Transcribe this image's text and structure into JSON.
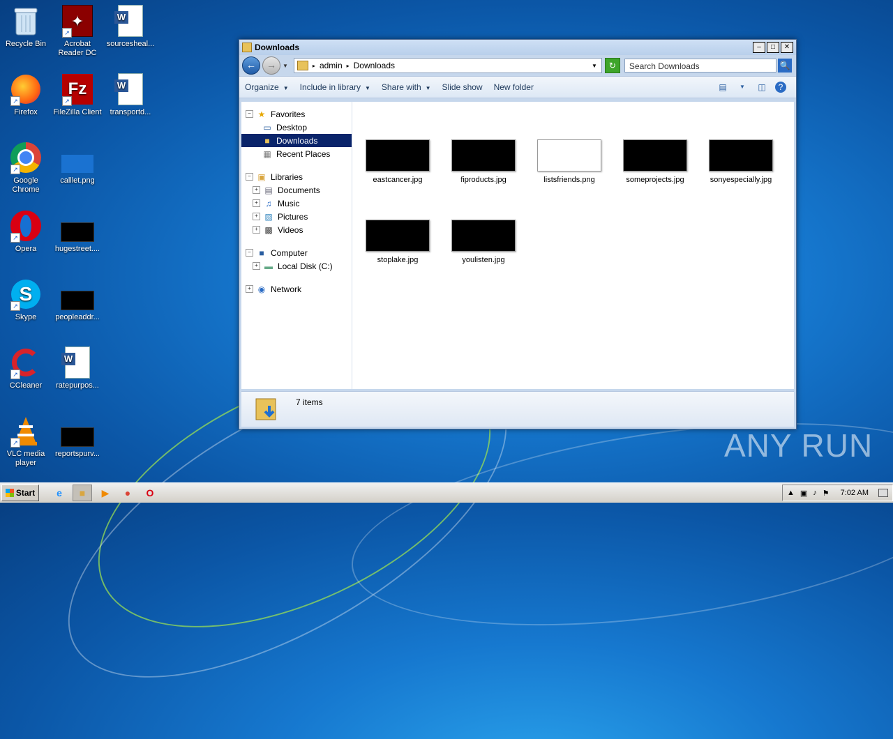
{
  "desktop": {
    "icons": [
      {
        "label": "Recycle Bin",
        "icon": "recycle-bin-icon"
      },
      {
        "label": "Acrobat Reader DC",
        "icon": "acrobat-icon"
      },
      {
        "label": "sourcesheal...",
        "icon": "word-doc-icon"
      },
      {
        "label": "Firefox",
        "icon": "firefox-icon"
      },
      {
        "label": "FileZilla Client",
        "icon": "filezilla-icon"
      },
      {
        "label": "transportd...",
        "icon": "word-doc-icon"
      },
      {
        "label": "Google Chrome",
        "icon": "chrome-icon"
      },
      {
        "label": "calllet.png",
        "icon": "image-icon"
      },
      {
        "label": "Opera",
        "icon": "opera-icon"
      },
      {
        "label": "hugestreet....",
        "icon": "image-icon"
      },
      {
        "label": "Skype",
        "icon": "skype-icon"
      },
      {
        "label": "peopleaddr...",
        "icon": "image-icon"
      },
      {
        "label": "CCleaner",
        "icon": "ccleaner-icon"
      },
      {
        "label": "ratepurpos...",
        "icon": "word-doc-icon"
      },
      {
        "label": "VLC media player",
        "icon": "vlc-icon"
      },
      {
        "label": "reportspurv...",
        "icon": "image-icon"
      }
    ]
  },
  "window": {
    "title": "Downloads",
    "breadcrumb": [
      "admin",
      "Downloads"
    ],
    "search_placeholder": "Search Downloads",
    "toolbar": {
      "organize": "Organize",
      "include_in_library": "Include in library",
      "share_with": "Share with",
      "slide_show": "Slide show",
      "new_folder": "New folder"
    },
    "nav": {
      "favorites": "Favorites",
      "desktop": "Desktop",
      "downloads": "Downloads",
      "recent_places": "Recent Places",
      "libraries": "Libraries",
      "documents": "Documents",
      "music": "Music",
      "pictures": "Pictures",
      "videos": "Videos",
      "computer": "Computer",
      "local_disk": "Local Disk (C:)",
      "network": "Network"
    },
    "files": [
      {
        "name": "eastcancer.jpg",
        "thumb": "dark"
      },
      {
        "name": "fiproducts.jpg",
        "thumb": "dark"
      },
      {
        "name": "listsfriends.png",
        "thumb": "light"
      },
      {
        "name": "someprojects.jpg",
        "thumb": "dark"
      },
      {
        "name": "sonyespecially.jpg",
        "thumb": "dark"
      },
      {
        "name": "stoplake.jpg",
        "thumb": "dark"
      },
      {
        "name": "youlisten.jpg",
        "thumb": "dark"
      }
    ],
    "status": "7 items"
  },
  "taskbar": {
    "start_label": "Start",
    "time": "7:02 AM"
  },
  "watermark": "ANY RUN"
}
